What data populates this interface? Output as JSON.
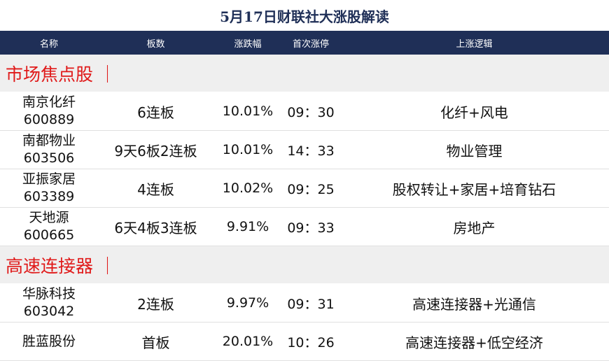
{
  "title": "5月17日财联社大涨股解读",
  "header": [
    "名称",
    "板数",
    "涨跌幅",
    "首次涨停",
    "上涨逻辑"
  ],
  "sections": [
    {
      "title": "市场焦点股 ｜",
      "rows": [
        {
          "name": "南京化纤",
          "code": "600889",
          "boards": "6连板",
          "change": "10.01%",
          "first_limit": "09：30",
          "logic": "化纤+风电"
        },
        {
          "name": "南都物业",
          "code": "603506",
          "boards": "9天6板2连板",
          "change": "10.01%",
          "first_limit": "14：33",
          "logic": "物业管理"
        },
        {
          "name": "亚振家居",
          "code": "603389",
          "boards": "4连板",
          "change": "10.02%",
          "first_limit": "09：25",
          "logic": "股权转让+家居+培育钻石"
        },
        {
          "name": "天地源",
          "code": "600665",
          "boards": "6天4板3连板",
          "change": "9.91%",
          "first_limit": "09：33",
          "logic": "房地产"
        }
      ]
    },
    {
      "title": "高速连接器 ｜",
      "rows": [
        {
          "name": "华脉科技",
          "code": "603042",
          "boards": "2连板",
          "change": "9.97%",
          "first_limit": "09：31",
          "logic": "高速连接器+光通信"
        },
        {
          "name": "胜蓝股份",
          "code": "",
          "boards": "首板",
          "change": "20.01%",
          "first_limit": "10：26",
          "logic": "高速连接器+低空经济"
        }
      ]
    }
  ],
  "colors": {
    "header_bg": "#1f2f57",
    "accent_red": "#e01a1a",
    "section_bg": "#efefef"
  }
}
